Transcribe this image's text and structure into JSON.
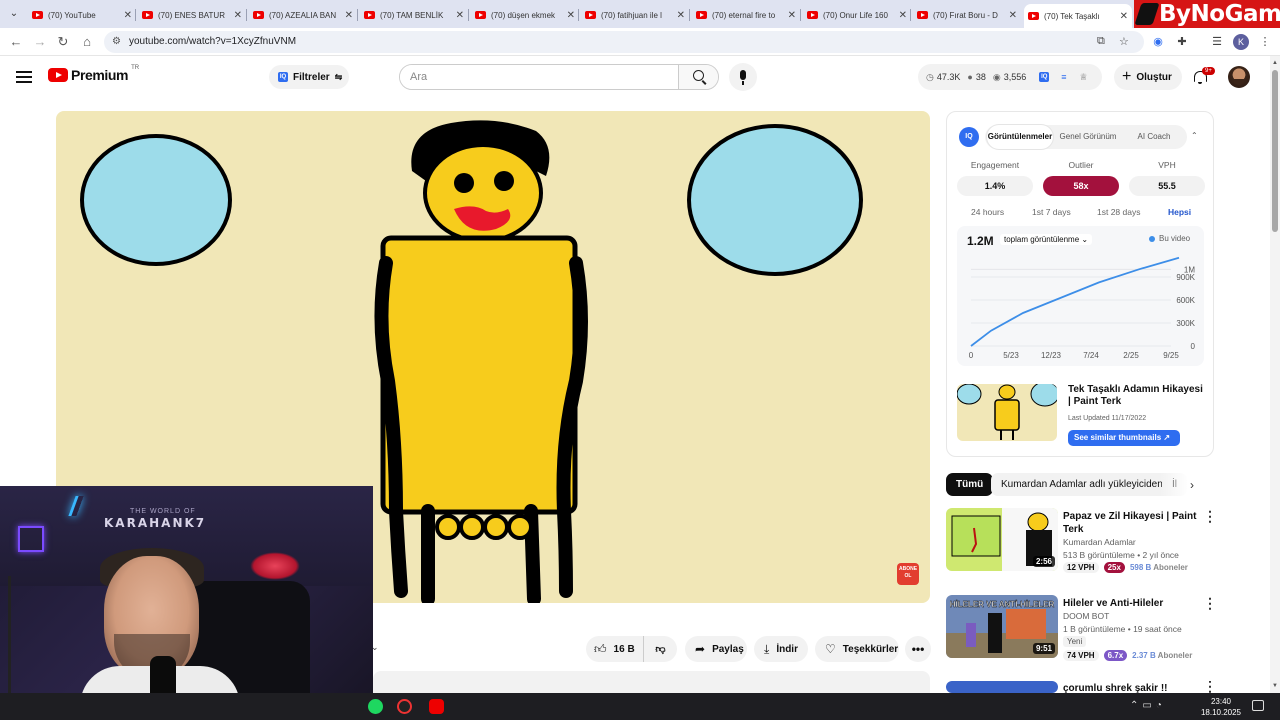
{
  "browser": {
    "tabs": [
      {
        "title": "(70) YouTube",
        "left": 28
      },
      {
        "title": "(70) ENES BATUR",
        "left": 138
      },
      {
        "title": "(70) AZEALIA BAN",
        "left": 249
      },
      {
        "title": "(70) TAM BENLİK",
        "left": 360
      },
      {
        "title": "(70) düşen ekmek",
        "left": 471
      },
      {
        "title": "(70) fatihjuan ile l",
        "left": 581
      },
      {
        "title": "(70) eternal fire to",
        "left": 692
      },
      {
        "title": "(70) Onur Life 160",
        "left": 803
      },
      {
        "title": "(70) Fırat Boru - D",
        "left": 913
      },
      {
        "title": "(70) Tek Taşaklı",
        "left": 1024
      }
    ],
    "tab_close": "✕",
    "url": "youtube.com/watch?v=1XcyZfnuVNM",
    "profile_initial": "K",
    "watermark": "ByNoGame"
  },
  "yt": {
    "logo_text": "Premium",
    "country": "TR",
    "filters_label": "Filtreler",
    "filters_badge": "IQ",
    "search_placeholder": "Ara",
    "stats": {
      "views": "47.3K",
      "likes": "38",
      "eyes": "3,556"
    },
    "create_label": "Oluştur",
    "notif_count": "9+"
  },
  "video": {
    "watermark_button": "ABONE OL",
    "actions": {
      "likes": "16 B",
      "share": "Paylaş",
      "download": "İndir",
      "thanks": "Teşekkürler",
      "more": "•••"
    }
  },
  "webcam": {
    "sign_small": "THE WORLD OF",
    "sign": "KARAHANK7"
  },
  "iq": {
    "logo": "IQ",
    "tabs": [
      "Görüntülenmeler",
      "Genel Görünüm",
      "AI Coach"
    ],
    "metrics": [
      {
        "label": "Engagement",
        "value": "1.4%"
      },
      {
        "label": "Outlier",
        "value": "58x"
      },
      {
        "label": "VPH",
        "value": "55.5"
      }
    ],
    "ranges": [
      "24 hours",
      "1st 7 days",
      "1st 28 days",
      "Hepsi"
    ],
    "chart_total": "1.2M",
    "chart_metric": "toplam görüntülenme",
    "chart_legend": "Bu video",
    "video_title": "Tek Taşaklı Adamın Hikayesi | Paint Terk",
    "last_updated": "Last Updated 11/17/2022",
    "similar_btn": "See similar thumbnails ↗"
  },
  "chart_data": {
    "type": "line",
    "x": [
      "0",
      "5/23",
      "12/23",
      "7/24",
      "2/25",
      "9/25"
    ],
    "y_ticks": [
      "0",
      "300K",
      "600K",
      "900K",
      "1M"
    ],
    "series": [
      {
        "name": "Bu video",
        "values": [
          0,
          200000,
          430000,
          620000,
          830000,
          1000000,
          1150000
        ],
        "x": [
          0,
          0.5,
          1.3,
          2.2,
          3.2,
          4.2,
          5.2
        ]
      }
    ],
    "ylim": [
      0,
      1200000
    ]
  },
  "chips": [
    "Tümü",
    "Kumardan Adamlar adlı yükleyiciden",
    "İl"
  ],
  "related": [
    {
      "title": "Papaz ve Zil Hikayesi | Paint Terk",
      "channel": "Kumardan Adamlar",
      "meta": "513 B görüntüleme • 2 yıl önce",
      "duration": "2:56",
      "vph": "12 VPH",
      "outlier": "25x",
      "outlier_color": "#a3113d",
      "subs_value": "598 B",
      "subs_label": "Aboneler"
    },
    {
      "title": "Hileler ve Anti-Hileler",
      "channel": "DOOM BOT",
      "meta": "1 B görüntüleme • 19 saat önce",
      "duration": "9:51",
      "newtag": "Yeni",
      "vph": "74 VPH",
      "outlier": "6.7x",
      "outlier_color": "#7c57c7",
      "subs_value": "2.37 B",
      "subs_label": "Aboneler",
      "thumb_text": "HİLELER VE ANTİ-HİLELER"
    },
    {
      "title": "çorumlu shrek şakir !!"
    }
  ],
  "taskbar": {
    "time": "23:40",
    "date": "18.10.2025"
  },
  "colors": {
    "accent": "#2f6df0",
    "outlier": "#a3113d",
    "yt_red": "#ff0000"
  }
}
